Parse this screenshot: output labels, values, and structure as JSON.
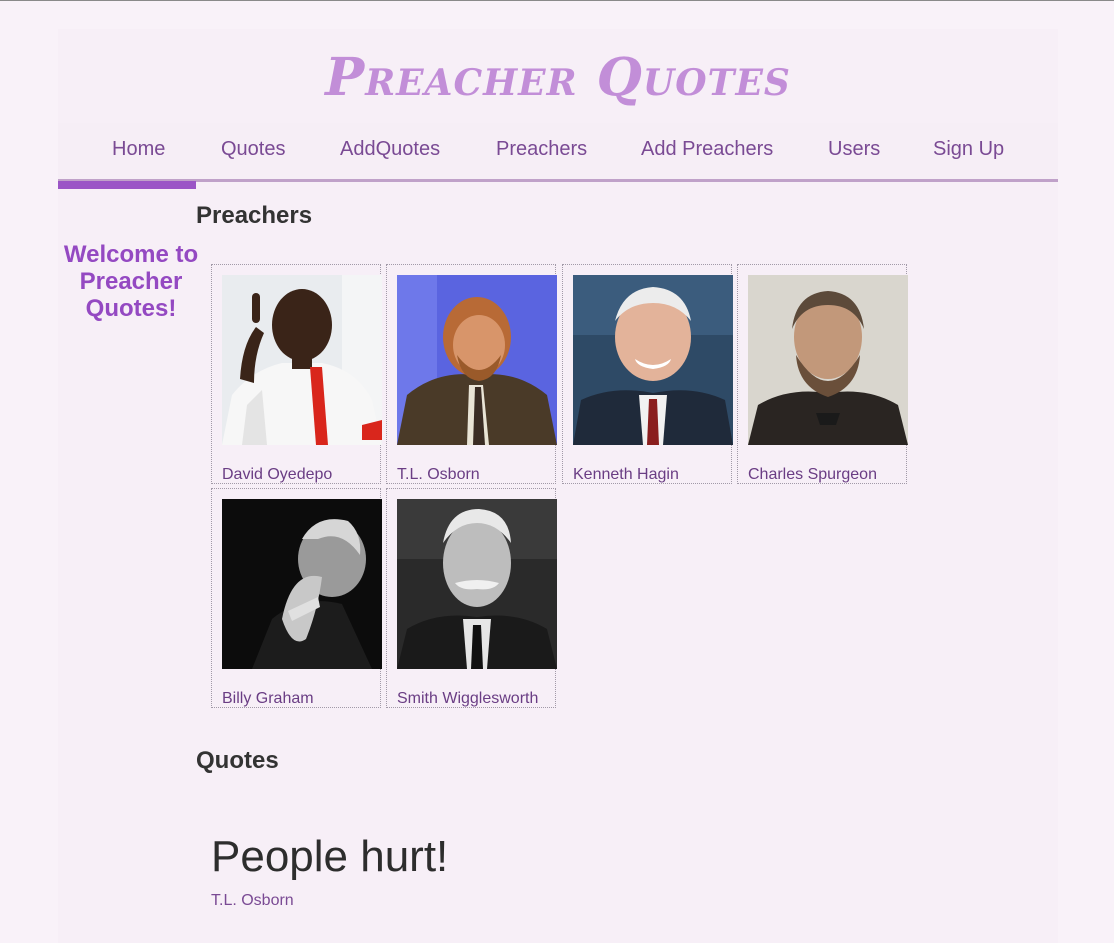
{
  "site": {
    "title": "Preacher Quotes"
  },
  "nav": {
    "items": [
      {
        "label": "Home"
      },
      {
        "label": "Quotes"
      },
      {
        "label": "AddQuotes"
      },
      {
        "label": "Preachers"
      },
      {
        "label": "Add Preachers"
      },
      {
        "label": "Users"
      },
      {
        "label": "Sign Up"
      }
    ],
    "active": "Home"
  },
  "sidebar": {
    "welcome": "Welcome to Preacher Quotes!"
  },
  "preachers": {
    "heading": "Preachers",
    "cards": [
      {
        "name": "David Oyedepo"
      },
      {
        "name": "T.L. Osborn"
      },
      {
        "name": "Kenneth Hagin"
      },
      {
        "name": "Charles Spurgeon"
      },
      {
        "name": "Billy Graham"
      },
      {
        "name": "Smith Wigglesworth"
      }
    ]
  },
  "quotes": {
    "heading": "Quotes",
    "items": [
      {
        "text": "People hurt!",
        "author": "T.L. Osborn"
      }
    ]
  },
  "colors": {
    "accent": "#9b55c6",
    "title": "#c28ed8",
    "nav_text": "#7a4a94",
    "background": "#f9f2f9"
  }
}
